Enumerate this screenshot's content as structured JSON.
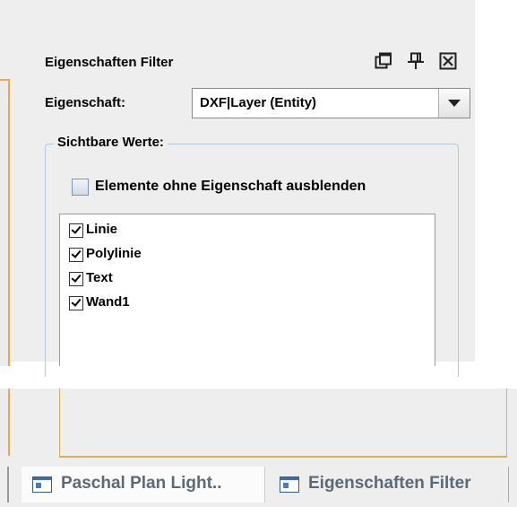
{
  "panel": {
    "title": "Eigenschaften Filter",
    "icons": [
      "restore-icon",
      "pin-icon",
      "close-icon"
    ]
  },
  "property": {
    "label": "Eigenschaft:",
    "selected": "DXF|Layer (Entity)"
  },
  "visible_values": {
    "group_title": "Sichtbare Werte:",
    "hide_checkbox_label": "Elemente ohne Eigenschaft ausblenden",
    "hide_checked": false,
    "items": [
      {
        "label": "Linie",
        "checked": true
      },
      {
        "label": "Polylinie",
        "checked": true
      },
      {
        "label": "Text",
        "checked": true
      },
      {
        "label": "Wand1",
        "checked": true
      }
    ]
  },
  "tabs": [
    {
      "label": "Paschal Plan Light..",
      "icon": "window-icon"
    },
    {
      "label": "Eigenschaften Filter",
      "icon": "window-icon"
    }
  ]
}
